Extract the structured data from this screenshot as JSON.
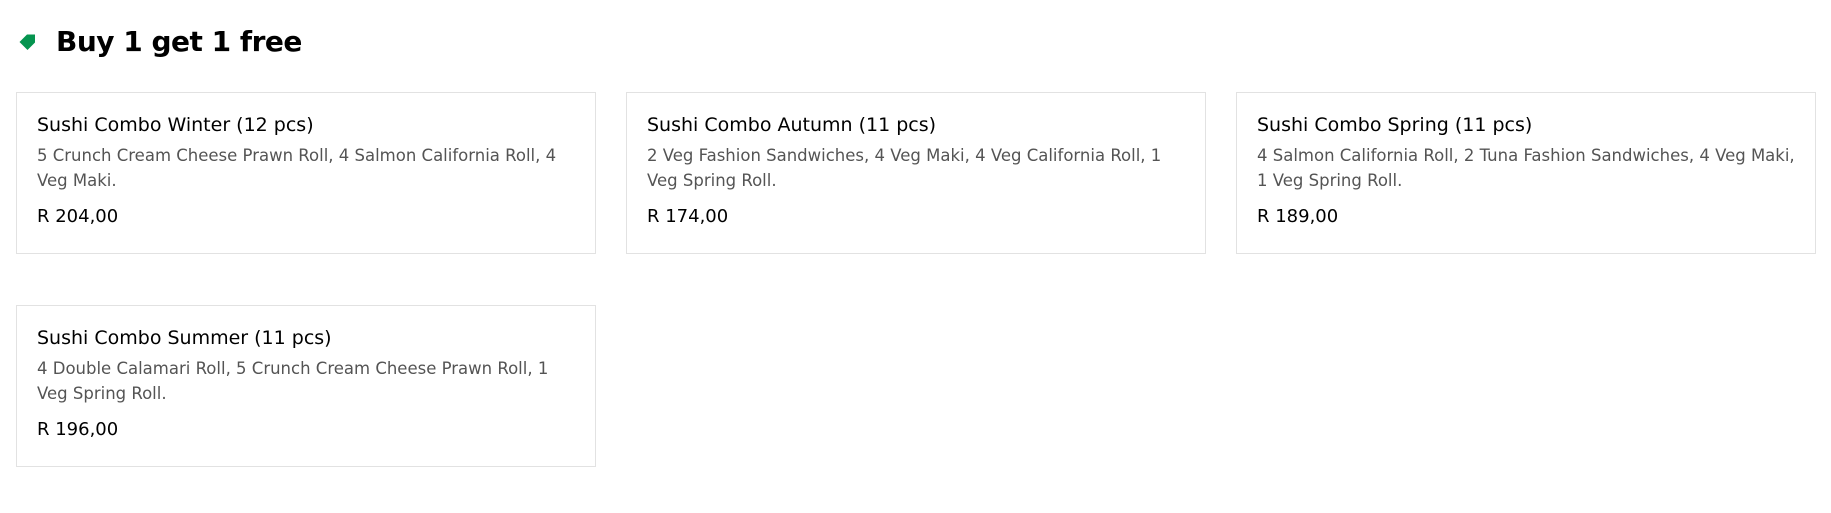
{
  "section": {
    "title": "Buy 1 get 1 free",
    "icon": "tag-icon",
    "icon_color": "#05944f"
  },
  "items": [
    {
      "name": "Sushi Combo Winter (12 pcs)",
      "description": "5 Crunch Cream Cheese Prawn Roll, 4 Salmon California Roll, 4 Veg Maki.",
      "price": "R 204,00"
    },
    {
      "name": "Sushi Combo Autumn (11 pcs)",
      "description": "2 Veg Fashion Sandwiches, 4 Veg Maki, 4 Veg California Roll, 1 Veg Spring Roll.",
      "price": "R 174,00"
    },
    {
      "name": "Sushi Combo Spring (11 pcs)",
      "description": "4 Salmon California Roll, 2 Tuna Fashion Sandwiches, 4 Veg Maki, 1 Veg Spring Roll.",
      "price": "R 189,00"
    },
    {
      "name": "Sushi Combo Summer (11 pcs)",
      "description": "4 Double Calamari Roll, 5 Crunch Cream Cheese Prawn Roll, 1 Veg Spring Roll.",
      "price": "R 196,00"
    }
  ]
}
